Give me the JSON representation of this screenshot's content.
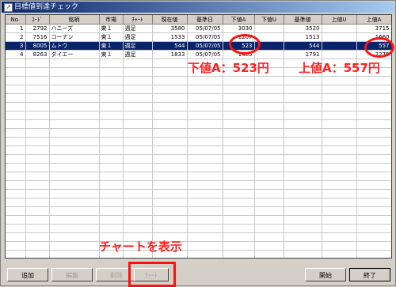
{
  "window": {
    "title": "目標値到達チェック"
  },
  "columns": [
    "No.",
    "ｺｰﾄﾞ",
    "銘柄",
    "市場",
    "ﾁｬｰﾄ",
    "現在値",
    "基準日",
    "下値A",
    "下値U",
    "基準値",
    "上値U",
    "上値A"
  ],
  "rows": [
    [
      "1",
      "2792",
      "ハニーズ",
      "東１",
      "週足",
      "3580",
      "05/07/05",
      "3030",
      "",
      "3520",
      "",
      "3715"
    ],
    [
      "2",
      "7516",
      "コーナン",
      "東１",
      "週足",
      "1533",
      "05/07/05",
      "1207",
      "",
      "1513",
      "",
      "1660"
    ],
    [
      "3",
      "8005",
      "ムトウ",
      "東１",
      "週足",
      "544",
      "05/07/05",
      "523",
      "",
      "544",
      "",
      "557"
    ],
    [
      "4",
      "8263",
      "ダイエー",
      "東１",
      "週足",
      "1833",
      "05/07/05",
      "1465",
      "",
      "1791",
      "",
      "2275"
    ]
  ],
  "selected_row": 2,
  "annotations": {
    "lower": "下値A：523円",
    "upper": "上値A：557円",
    "chart": "チャートを表示"
  },
  "buttons": {
    "add": "追加",
    "edit": "編集",
    "delete": "削除",
    "chart": "ﾁｬｰﾄ",
    "start": "開始",
    "exit": "終了"
  },
  "colors": {
    "annotation": "#ff2020",
    "selection": "#0a246a"
  }
}
